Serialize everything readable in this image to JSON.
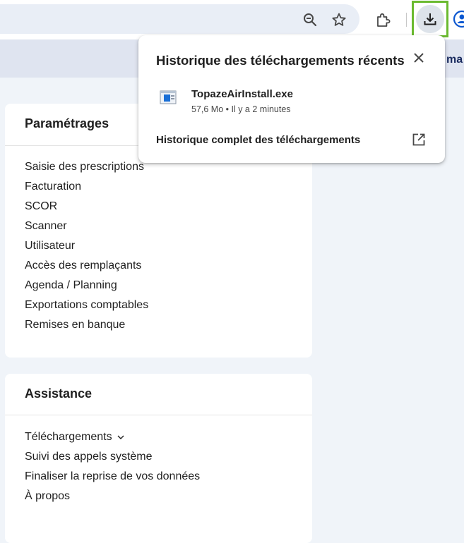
{
  "browser": {
    "icons": {
      "zoom": "zoom-out-icon",
      "bookmark": "star-icon",
      "extensions": "puzzle-icon",
      "downloads": "download-icon",
      "profile": "profile-icon"
    },
    "highlight_color": "#6aba2f"
  },
  "page_band": {
    "clipped_text": "ma"
  },
  "downloads_popup": {
    "title": "Historique des téléchargements récents",
    "close_icon": "close-icon",
    "items": [
      {
        "file_name": "TopazeAirInstall.exe",
        "meta": "57,6 Mo • Il y a 2 minutes",
        "icon": "exe-file-icon"
      }
    ],
    "full_history_label": "Historique complet des téléchargements",
    "open_icon": "open-in-new-icon"
  },
  "settings_card": {
    "title": "Paramétrages",
    "items": [
      "Saisie des prescriptions",
      "Facturation",
      "SCOR",
      "Scanner",
      "Utilisateur",
      "Accès des remplaçants",
      "Agenda / Planning",
      "Exportations comptables",
      "Remises en banque"
    ]
  },
  "assistance_card": {
    "title": "Assistance",
    "items": [
      "Téléchargements",
      "Suivi des appels système",
      "Finaliser la reprise de vos données",
      "À propos"
    ]
  }
}
